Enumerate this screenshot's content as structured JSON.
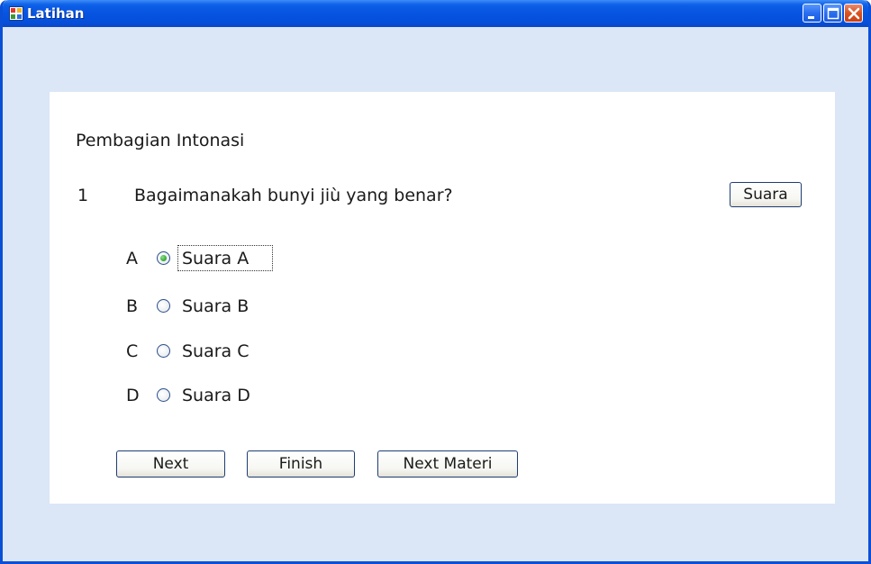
{
  "window": {
    "title": "Latihan"
  },
  "quiz": {
    "heading": "Pembagian Intonasi",
    "question_number": "1",
    "question_text": "Bagaimanakah bunyi jiù yang benar?",
    "sound_button_label": "Suara",
    "options": [
      {
        "letter": "A",
        "label": "Suara A",
        "selected": true
      },
      {
        "letter": "B",
        "label": "Suara B",
        "selected": false
      },
      {
        "letter": "C",
        "label": "Suara C",
        "selected": false
      },
      {
        "letter": "D",
        "label": "Suara D",
        "selected": false
      }
    ]
  },
  "actions": {
    "next_label": "Next",
    "finish_label": "Finish",
    "next_materi_label": "Next Materi"
  },
  "colors": {
    "titlebar": "#0654e0",
    "form_background": "#dbe6f7",
    "panel_background": "#ffffff"
  }
}
